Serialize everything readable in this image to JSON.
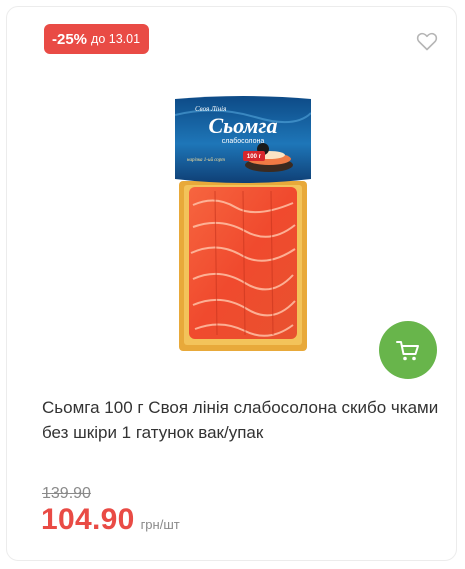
{
  "badge": {
    "discount": "-25%",
    "until": "до 13.01"
  },
  "product": {
    "title": "Сьомга 100 г Своя лінія слабосолона скибо чками без шкіри 1 гатунок вак/упак",
    "package": {
      "brand": "Своя Лінія",
      "name": "Сьомга",
      "subname": "слабосолона",
      "note": "нарізка 1-ий сорт",
      "weight": "100 г"
    }
  },
  "price": {
    "old": "139.90",
    "current": "104.90",
    "unit": "грн/шт"
  },
  "icons": {
    "favorite": "heart-icon",
    "cart": "cart-icon"
  },
  "colors": {
    "accent_red": "#e94b45",
    "cart_green": "#68b54b"
  }
}
